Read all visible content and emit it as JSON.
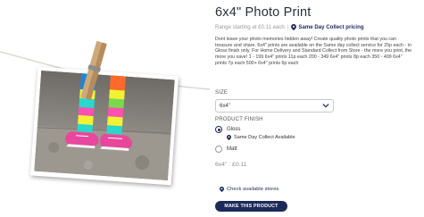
{
  "product": {
    "title": "6x4\" Photo Print",
    "price_from": "Range starting at £0.11 each",
    "separator": "|",
    "collect_link": "Same Day Collect pricing",
    "description": "Dont leave your photo memories hidden away! Create quality photo prints that you can treasure and share. 6x4\" prints are available on the Same day collect service for 25p each - in Gloss finish only. For Home Delivery and Standard Collect from Store - the more you print, the more you save! 1 - 199 6x4\" prints 11p each 200 - 349 6x4\" prints 8p each 350 - 499 6x4\" prints 7p each 500+ 6x4\" prints 6p each"
  },
  "size": {
    "label": "SIZE",
    "selected": "6x4\""
  },
  "finish": {
    "label": "PRODUCT FINISH",
    "options": [
      {
        "label": "Gloss",
        "selected": true,
        "note": "Same Day Collect Available"
      },
      {
        "label": "Matt",
        "selected": false
      }
    ]
  },
  "unit_price": "6x4\" : £0.11",
  "stores_link": "Check available stores",
  "cta_label": "MAKE THIS PRODUCT",
  "colors": {
    "brand_navy": "#1c2a5a",
    "muted_text": "#9a9a9a"
  },
  "icons": {
    "location": "location-pin-icon",
    "dropdown": "chevron-down-icon"
  }
}
